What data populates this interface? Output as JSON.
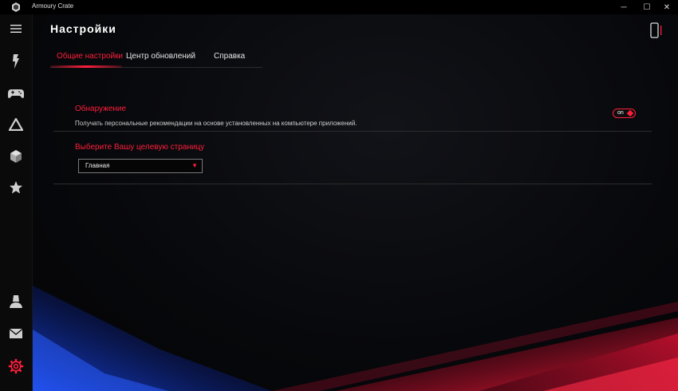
{
  "window": {
    "title": "Armoury Crate",
    "minimize_glyph": "─",
    "maximize_glyph": "☐",
    "close_glyph": "✕"
  },
  "sidebar": {
    "items": [
      {
        "icon": "hamburger-menu-icon"
      },
      {
        "icon": "home-logo-icon"
      },
      {
        "icon": "gamepad-icon"
      },
      {
        "icon": "aura-triangle-icon"
      },
      {
        "icon": "cube-icon"
      },
      {
        "icon": "star-icon"
      },
      {
        "icon": "user-icon"
      },
      {
        "icon": "mail-icon"
      },
      {
        "icon": "gear-icon",
        "active": true
      }
    ]
  },
  "page": {
    "title": "Настройки",
    "device_icon": "phone-device-icon"
  },
  "tabs": [
    {
      "label": "Общие настройки",
      "active": true
    },
    {
      "label": "Центр обновлений",
      "active": false
    },
    {
      "label": "Справка",
      "active": false
    }
  ],
  "settings": {
    "discovery": {
      "title": "Обнаружение",
      "description": "Получать персональные рекомендации на основе установленных на компьютере приложений.",
      "toggle_label": "on",
      "toggle_state": true
    },
    "landing_page": {
      "title": "Выберите Вашу целевую страницу",
      "selected": "Главная",
      "arrow": "▼"
    }
  },
  "colors": {
    "accent": "#ff1e3c",
    "background": "#000000",
    "text": "#ffffff"
  }
}
